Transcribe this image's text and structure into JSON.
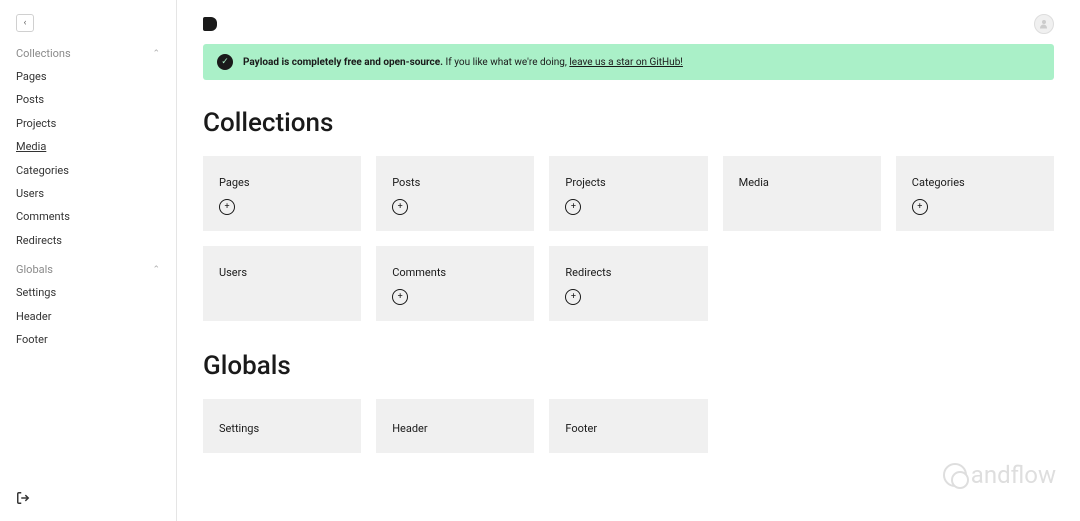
{
  "sidebar": {
    "groups": [
      {
        "label": "Collections",
        "items": [
          {
            "label": "Pages",
            "active": false
          },
          {
            "label": "Posts",
            "active": false
          },
          {
            "label": "Projects",
            "active": false
          },
          {
            "label": "Media",
            "active": true
          },
          {
            "label": "Categories",
            "active": false
          },
          {
            "label": "Users",
            "active": false
          },
          {
            "label": "Comments",
            "active": false
          },
          {
            "label": "Redirects",
            "active": false
          }
        ]
      },
      {
        "label": "Globals",
        "items": [
          {
            "label": "Settings",
            "active": false
          },
          {
            "label": "Header",
            "active": false
          },
          {
            "label": "Footer",
            "active": false
          }
        ]
      }
    ]
  },
  "banner": {
    "bold": "Payload is completely free and open-source.",
    "text": " If you like what we're doing, ",
    "link": "leave us a star on GitHub!"
  },
  "sections": {
    "collections": {
      "title": "Collections",
      "cards": [
        {
          "title": "Pages",
          "has_add": true
        },
        {
          "title": "Posts",
          "has_add": true
        },
        {
          "title": "Projects",
          "has_add": true
        },
        {
          "title": "Media",
          "has_add": false
        },
        {
          "title": "Categories",
          "has_add": true
        },
        {
          "title": "Users",
          "has_add": false
        },
        {
          "title": "Comments",
          "has_add": true
        },
        {
          "title": "Redirects",
          "has_add": true
        }
      ]
    },
    "globals": {
      "title": "Globals",
      "cards": [
        {
          "title": "Settings"
        },
        {
          "title": "Header"
        },
        {
          "title": "Footer"
        }
      ]
    }
  },
  "watermark": "andflow"
}
